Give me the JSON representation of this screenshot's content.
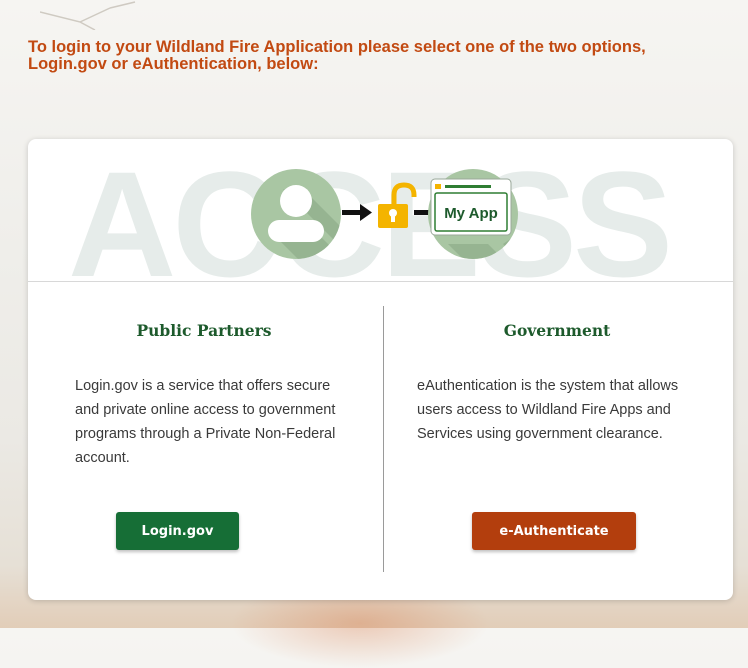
{
  "heading": "To login to your Wildland Fire Application please select one of the two options, Login.gov or eAuthentication, below:",
  "banner": {
    "watermark": "ACCESS",
    "app_label": "My App",
    "icons": [
      "user-icon",
      "arrow-right-icon",
      "unlocked-padlock-icon",
      "app-window-icon"
    ]
  },
  "public_partners": {
    "title": "Public Partners",
    "description": "Login.gov is a service that offers secure and private online access to government programs through a Private Non-Federal account.",
    "button_label": "Login.gov"
  },
  "government": {
    "title": "Government",
    "description": "eAuthentication is the system that allows users access to Wildland Fire Apps and Services using government clearance.",
    "button_label": "e-Authenticate"
  },
  "colors": {
    "heading": "#c24a12",
    "title_green": "#1d5a2c",
    "login_button": "#166e36",
    "eauth_button": "#b33e0d",
    "padlock": "#f4b400"
  }
}
